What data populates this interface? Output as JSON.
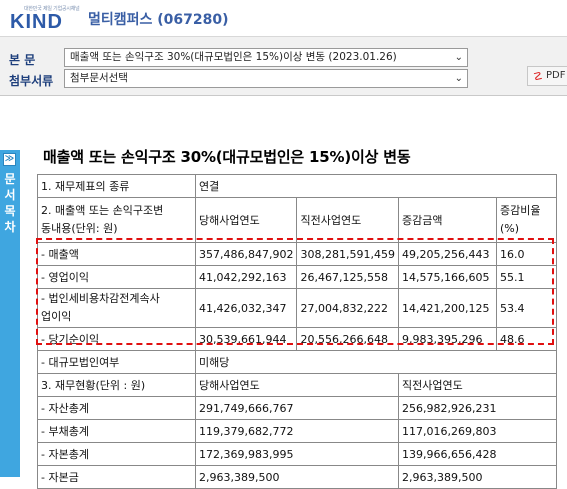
{
  "app": {
    "logo_text": "KIND",
    "logo_tagline": "대한민국 제일 기업공시채널",
    "company": "멀티캠퍼스 (067280)"
  },
  "toolbar": {
    "main_label": "본 문",
    "main_select": "매출액 또는 손익구조 30%(대규모법인은 15%)이상 변동 (2023.01.26)",
    "attach_label": "첨부서류",
    "attach_select": "첨부문서선택",
    "pdf_label": "PDF"
  },
  "sidebar": {
    "toggle": "≫",
    "chars": [
      "문",
      "서",
      "목",
      "차"
    ]
  },
  "document": {
    "title": "매출액 또는 손익구조 30%(대규모법인은 15%)이상 변동",
    "rows": {
      "r1": {
        "label": "1. 재무제표의 종류",
        "value": "연결"
      },
      "r2": {
        "label_line1": "2. 매출액 또는 손익구조변",
        "label_line2": "동내용(단위: 원)",
        "h1": "당해사업연도",
        "h2": "직전사업연도",
        "h3": "증감금액",
        "h4_line1": "증감비율",
        "h4_line2": "(%)"
      },
      "revenue": {
        "label": "- 매출액",
        "cur": "357,486,847,902",
        "prev": "308,281,591,459",
        "diff": "49,205,256,443",
        "rate": "16.0"
      },
      "op": {
        "label": "- 영업이익",
        "cur": "41,042,292,163",
        "prev": "26,467,125,558",
        "diff": "14,575,166,605",
        "rate": "55.1"
      },
      "pretax": {
        "label_line1": "- 법인세비용차감전계속사",
        "label_line2": "업이익",
        "cur": "41,426,032,347",
        "prev": "27,004,832,222",
        "diff": "14,421,200,125",
        "rate": "53.4"
      },
      "net": {
        "label": "- 당기순이익",
        "cur": "30,539,661,944",
        "prev": "20,556,266,648",
        "diff": "9,983,395,296",
        "rate": "48.6"
      },
      "large": {
        "label": "- 대규모법인여부",
        "value": "미해당"
      },
      "r3": {
        "label": "3. 재무현황(단위 : 원)",
        "h1": "당해사업연도",
        "h2": "직전사업연도"
      },
      "assets": {
        "label": "- 자산총계",
        "cur": "291,749,666,767",
        "prev": "256,982,926,231"
      },
      "liab": {
        "label": "- 부채총계",
        "cur": "119,379,682,772",
        "prev": "117,016,269,803"
      },
      "equity": {
        "label": "- 자본총계",
        "cur": "172,369,983,995",
        "prev": "139,966,656,428"
      },
      "capital": {
        "label": "- 자본금",
        "cur": "2,963,389,500",
        "prev": "2,963,389,500"
      }
    }
  },
  "colors": {
    "brand_blue": "#2d5aa8",
    "brand_orange": "#f08a1c",
    "side_tab": "#3fa6e0",
    "highlight_dash": "#e01010"
  }
}
